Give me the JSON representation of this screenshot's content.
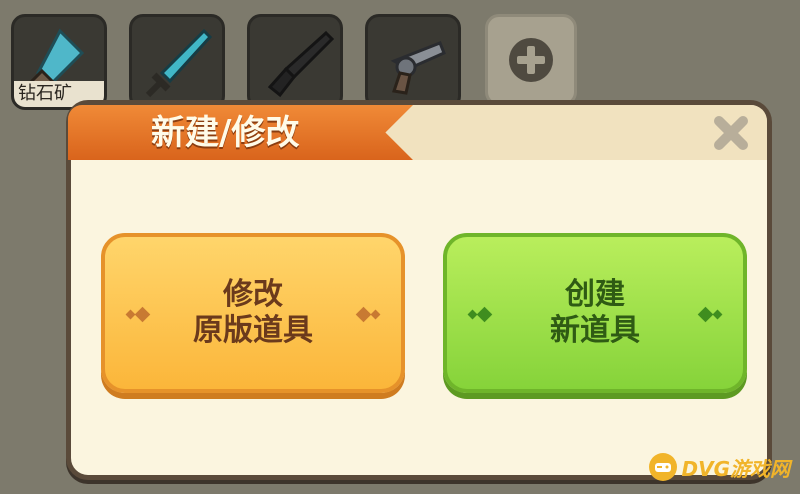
{
  "item_bar": {
    "items": [
      {
        "label": "钻石矿",
        "icon": "diamond-drill-icon"
      },
      {
        "label": "",
        "icon": "diamond-sword-icon"
      },
      {
        "label": "",
        "icon": "dark-rifle-icon"
      },
      {
        "label": "",
        "icon": "revolver-icon"
      }
    ],
    "add_icon": "plus-icon"
  },
  "dialog": {
    "title": "新建/修改",
    "close_icon": "close-icon",
    "modify_button": {
      "line1": "修改",
      "line2": "原版道具"
    },
    "create_button": {
      "line1": "创建",
      "line2": "新道具"
    }
  },
  "watermark": {
    "text": "DVG游戏网"
  },
  "colors": {
    "title_ribbon": "#e8782a",
    "modify_button": "#fbc04a",
    "create_button": "#9ce04a",
    "watermark": "#f1b42a"
  }
}
